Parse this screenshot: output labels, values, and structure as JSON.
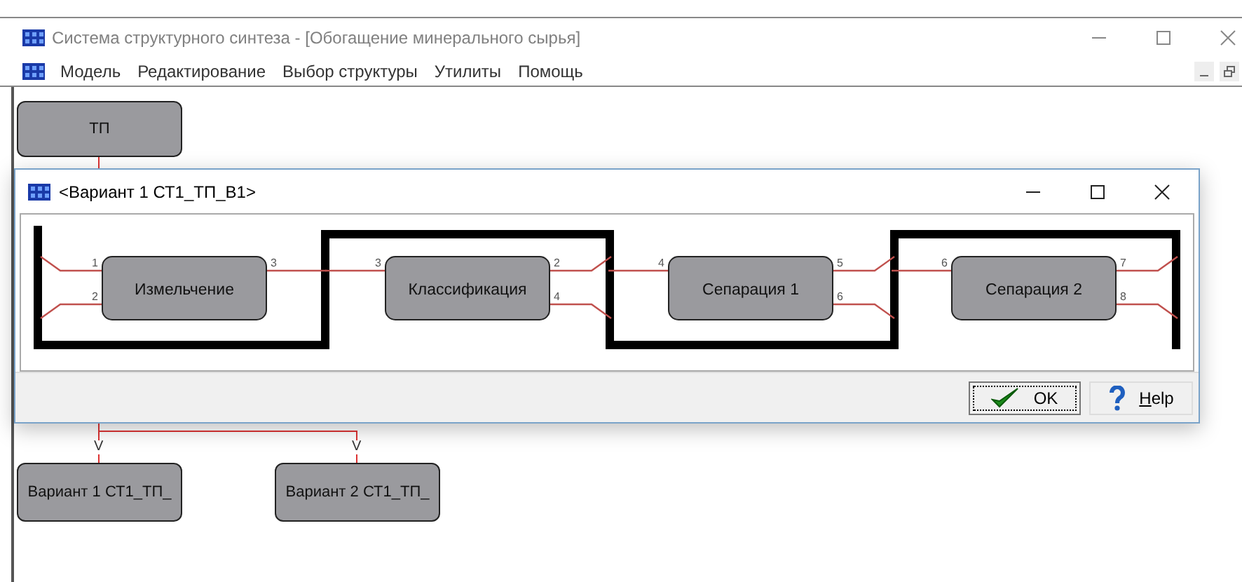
{
  "window": {
    "title": "Система структурного синтеза - [Обогащение минерального сырья]"
  },
  "menu": [
    "Модель",
    "Редактирование",
    "Выбор структуры",
    "Утилиты",
    "Помощь"
  ],
  "canvas": {
    "top_node": "ТП",
    "connector_marks": [
      "V",
      "V"
    ],
    "variant_nodes": [
      "Вариант 1 СТ1_ТП_",
      "Вариант 2 СТ1_ТП_"
    ]
  },
  "dialog": {
    "title": "<Вариант 1 СТ1_ТП_В1>",
    "blocks": [
      {
        "name": "Измельчение",
        "inputs": [
          "1",
          "2"
        ],
        "outputs": [
          "3"
        ]
      },
      {
        "name": "Классификация",
        "inputs": [
          "3"
        ],
        "outputs": [
          "2",
          "4"
        ]
      },
      {
        "name": "Сепарация 1",
        "inputs": [
          "4"
        ],
        "outputs": [
          "5",
          "6"
        ]
      },
      {
        "name": "Сепарация 2",
        "inputs": [
          "6"
        ],
        "outputs": [
          "7",
          "8"
        ]
      }
    ],
    "buttons": [
      {
        "kind": "ok",
        "label": "OK"
      },
      {
        "kind": "help",
        "label": "Help"
      }
    ]
  }
}
